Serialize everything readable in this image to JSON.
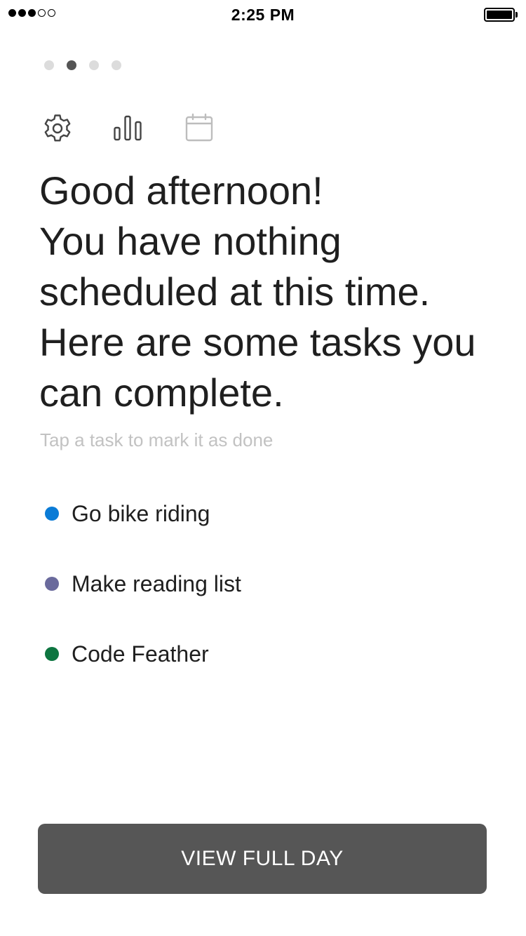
{
  "status_bar": {
    "time": "2:25 PM",
    "signal_filled": 3,
    "signal_total": 5
  },
  "page_indicator": {
    "count": 4,
    "active_index": 1
  },
  "toolbar": {
    "icons": [
      "gear-icon",
      "bar-chart-icon",
      "calendar-icon"
    ]
  },
  "greeting": {
    "lines": [
      "Good afternoon!",
      "You have nothing",
      "scheduled at this time.",
      "Here are some tasks you",
      "can complete."
    ]
  },
  "hint": "Tap a task to mark it as done",
  "tasks": [
    {
      "label": "Go bike riding",
      "color": "#0a7bd6"
    },
    {
      "label": "Make reading list",
      "color": "#6a6a9c"
    },
    {
      "label": "Code Feather",
      "color": "#0d7540"
    }
  ],
  "footer": {
    "button_label": "VIEW FULL DAY",
    "button_color": "#565656"
  }
}
